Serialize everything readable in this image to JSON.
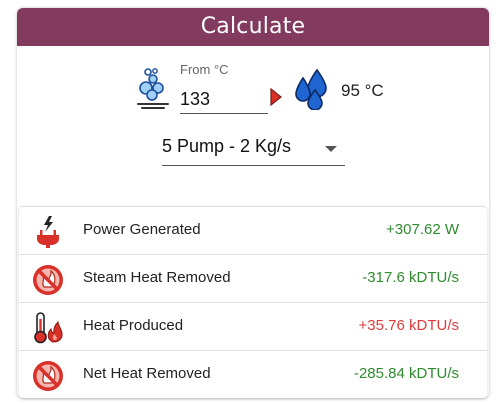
{
  "header": {
    "title": "Calculate"
  },
  "calc": {
    "from_label": "From °C",
    "from_value": "133",
    "to_value": "95 °C",
    "steam_icon": "steam-icon",
    "water_icon": "water-drops-icon",
    "arrow_icon": "arrow-right-icon"
  },
  "pump_select": {
    "value": "5 Pump - 2 Kg/s"
  },
  "results": [
    {
      "icon": "power-plug-icon",
      "label": "Power Generated",
      "value": "+307.62 W"
    },
    {
      "icon": "no-heat-icon",
      "label": "Steam Heat Removed",
      "value": "-317.6 kDTU/s"
    },
    {
      "icon": "thermometer-flame-icon",
      "label": "Heat Produced",
      "value": "+35.76 kDTU/s"
    },
    {
      "icon": "no-heat-icon",
      "label": "Net Heat Removed",
      "value": "-285.84 kDTU/s"
    }
  ],
  "colors": {
    "header": "#833a5f",
    "positive": "#2e8b2e",
    "heat": "#e03a3a",
    "icon_red": "#d9302a"
  }
}
